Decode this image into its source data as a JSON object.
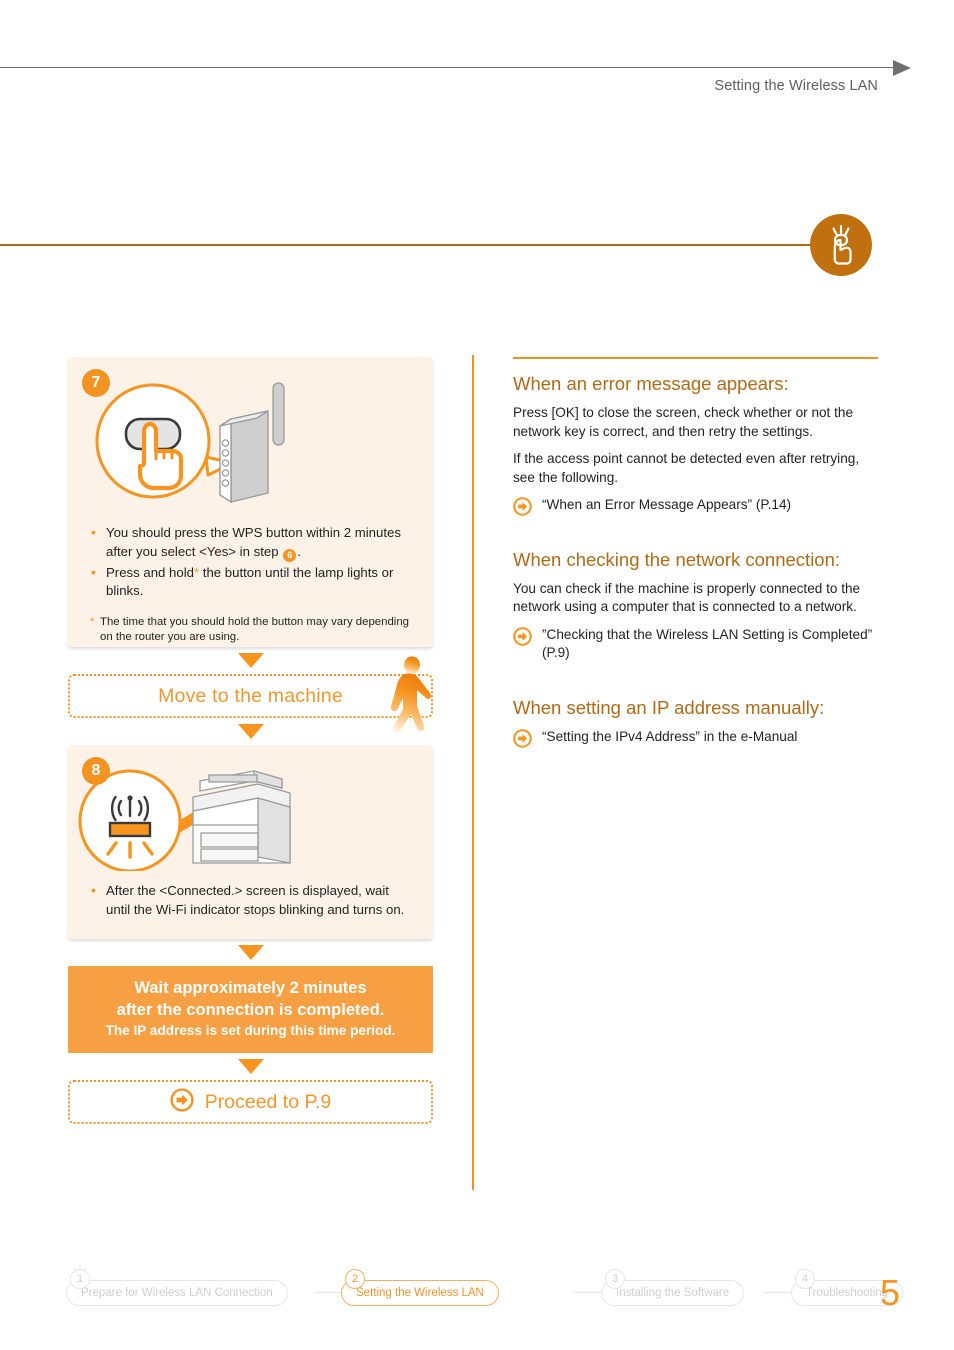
{
  "header": {
    "title": "Setting the Wireless LAN",
    "icon": "hand-press-button-icon"
  },
  "left_column": {
    "step7": {
      "number": "7",
      "illustration": "wps-button-router-illustration",
      "bullets": [
        {
          "pre": "You should press the WPS button within 2 minutes after you select <Yes> in step ",
          "badge": "6",
          "post": "."
        },
        {
          "pre": "Press and hold",
          "asterisk": "*",
          "post": " the button until the lamp lights or blinks."
        }
      ],
      "footnote": {
        "marker": "*",
        "text": "The time that you should hold the button may vary depending on the router you are using."
      }
    },
    "move_box": {
      "label": "Move to the machine",
      "icon": "walking-person-icon"
    },
    "step8": {
      "number": "8",
      "illustration": "printer-wifi-indicator-illustration",
      "bullets": [
        "After the <Connected.> screen is displayed, wait until the Wi-Fi indicator stops blinking and turns on."
      ]
    },
    "banner": {
      "line1": "Wait approximately 2 minutes",
      "line2": "after the connection is completed.",
      "line3": "The IP address is set during this time period."
    },
    "proceed_box": {
      "icon": "arrow-circle-right-icon",
      "label": "Proceed to P.9"
    }
  },
  "right_column": {
    "sections": [
      {
        "heading": "When an error message appears:",
        "paragraphs": [
          "Press [OK] to close the screen, check whether or not the network key is correct, and then retry the settings.",
          "If the access point cannot be detected even after retrying, see the following."
        ],
        "links": [
          "“When an Error Message Appears” (P.14)"
        ]
      },
      {
        "heading": "When checking the network connection:",
        "paragraphs": [
          "You can check if the machine is properly connected to the network using a computer that is connected to a network."
        ],
        "links": [
          "”Checking that the Wireless LAN Setting is Completed” (P.9)"
        ]
      },
      {
        "heading": "When setting an IP address manually:",
        "paragraphs": [],
        "links": [
          "“Setting the IPv4 Address” in the e-Manual"
        ]
      }
    ]
  },
  "footer": {
    "nav": [
      {
        "num": "1",
        "label": "Prepare for Wireless LAN Connection",
        "active": false
      },
      {
        "num": "2",
        "label": "Setting the Wireless LAN",
        "active": true
      },
      {
        "num": "3",
        "label": "Installing the Software",
        "active": false
      },
      {
        "num": "4",
        "label": "Troubleshooting",
        "active": false
      }
    ],
    "page_number": "5"
  },
  "colors": {
    "orange": "#f6941f",
    "dark_orange": "#b06a15",
    "banner_orange": "#f7a043",
    "box_bg": "#fdf2e8",
    "gray_text": "#5e5e5e"
  }
}
